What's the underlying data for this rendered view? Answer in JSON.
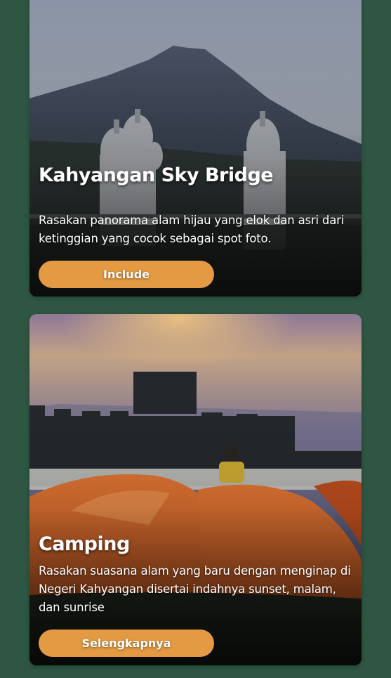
{
  "cards": [
    {
      "title": "Kahyangan Sky Bridge",
      "description": "Rasakan panorama alam hijau yang elok dan asri dari ketinggian yang cocok sebagai spot foto.",
      "button_label": "Include",
      "image": "mountain-sky-bridge-photo"
    },
    {
      "title": "Camping",
      "description": "Rasakan suasana alam yang baru dengan menginap di Negeri Kahyangan disertai indahnya sunset, malam, dan sunrise",
      "button_label": "Selengkapnya",
      "image": "camping-tents-sunset-photo"
    }
  ],
  "colors": {
    "page_background": "#2e5642",
    "button": "#e39a43",
    "text": "#ffffff"
  }
}
